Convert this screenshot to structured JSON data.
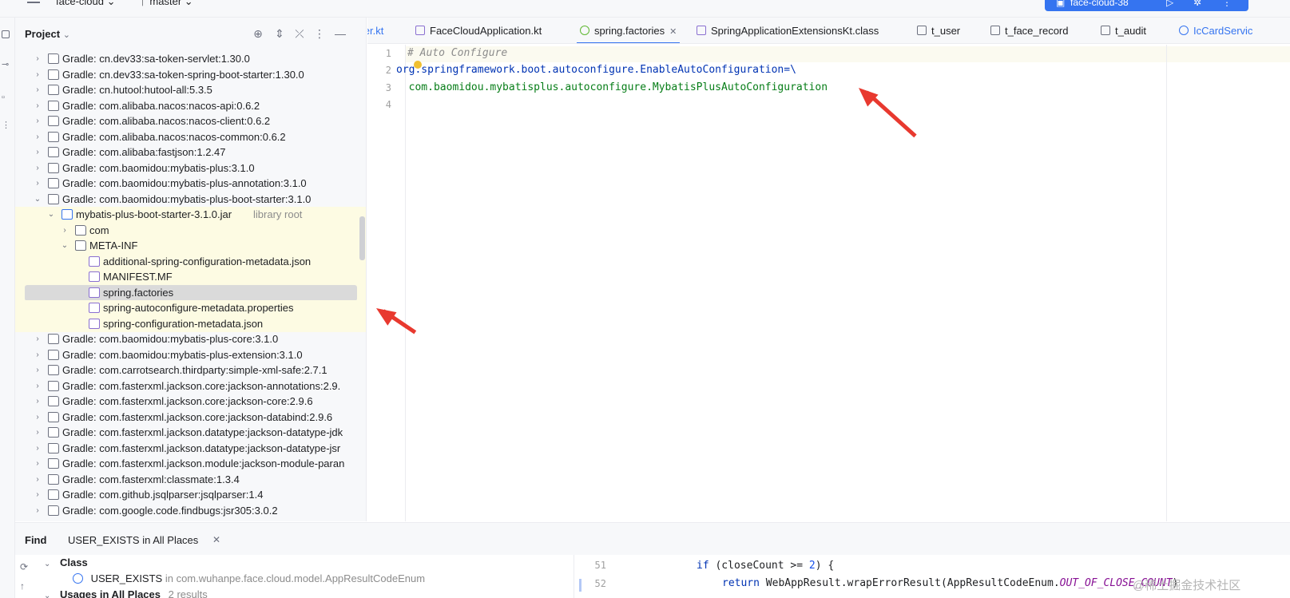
{
  "topbar": {
    "project_name": "face-cloud",
    "branch": "master",
    "run_config": "face-cloud-38"
  },
  "project_panel": {
    "title": "Project",
    "tree": [
      {
        "label": "Gradle: cn.dev33:sa-token-servlet:1.30.0"
      },
      {
        "label": "Gradle: cn.dev33:sa-token-spring-boot-starter:1.30.0"
      },
      {
        "label": "Gradle: cn.hutool:hutool-all:5.3.5"
      },
      {
        "label": "Gradle: com.alibaba.nacos:nacos-api:0.6.2"
      },
      {
        "label": "Gradle: com.alibaba.nacos:nacos-client:0.6.2"
      },
      {
        "label": "Gradle: com.alibaba.nacos:nacos-common:0.6.2"
      },
      {
        "label": "Gradle: com.alibaba:fastjson:1.2.47"
      },
      {
        "label": "Gradle: com.baomidou:mybatis-plus:3.1.0"
      },
      {
        "label": "Gradle: com.baomidou:mybatis-plus-annotation:3.1.0"
      },
      {
        "label": "Gradle: com.baomidou:mybatis-plus-boot-starter:3.1.0"
      },
      {
        "label": "mybatis-plus-boot-starter-3.1.0.jar",
        "suffix": "library root"
      },
      {
        "label": "com"
      },
      {
        "label": "META-INF"
      },
      {
        "label": "additional-spring-configuration-metadata.json"
      },
      {
        "label": "MANIFEST.MF"
      },
      {
        "label": "spring.factories"
      },
      {
        "label": "spring-autoconfigure-metadata.properties"
      },
      {
        "label": "spring-configuration-metadata.json"
      },
      {
        "label": "Gradle: com.baomidou:mybatis-plus-core:3.1.0"
      },
      {
        "label": "Gradle: com.baomidou:mybatis-plus-extension:3.1.0"
      },
      {
        "label": "Gradle: com.carrotsearch.thirdparty:simple-xml-safe:2.7.1"
      },
      {
        "label": "Gradle: com.fasterxml.jackson.core:jackson-annotations:2.9."
      },
      {
        "label": "Gradle: com.fasterxml.jackson.core:jackson-core:2.9.6"
      },
      {
        "label": "Gradle: com.fasterxml.jackson.core:jackson-databind:2.9.6"
      },
      {
        "label": "Gradle: com.fasterxml.jackson.datatype:jackson-datatype-jdk"
      },
      {
        "label": "Gradle: com.fasterxml.jackson.datatype:jackson-datatype-jsr"
      },
      {
        "label": "Gradle: com.fasterxml.jackson.module:jackson-module-paran"
      },
      {
        "label": "Gradle: com.fasterxml:classmate:1.3.4"
      },
      {
        "label": "Gradle: com.github.jsqlparser:jsqlparser:1.4"
      },
      {
        "label": "Gradle: com.google.code.findbugs:jsr305:3.0.2"
      }
    ]
  },
  "tabs": [
    {
      "label": "ller.kt"
    },
    {
      "label": "FaceCloudApplication.kt"
    },
    {
      "label": "spring.factories",
      "active": true
    },
    {
      "label": "SpringApplicationExtensionsKt.class"
    },
    {
      "label": "t_user"
    },
    {
      "label": "t_face_record"
    },
    {
      "label": "t_audit"
    },
    {
      "label": "IcCardServic"
    }
  ],
  "editor": {
    "line_numbers": [
      "1",
      "2",
      "3",
      "4"
    ],
    "lines": [
      {
        "text": "# Auto Configure"
      },
      {
        "key": "org.springframework.boot.autoconfigure.EnableAutoConfiguration",
        "sep": "=\\"
      },
      {
        "text": "  com.baomidou.mybatisplus.autoconfigure.MybatisPlusAutoConfiguration"
      },
      {
        "text": ""
      }
    ]
  },
  "find_panel": {
    "title": "Find",
    "tab_label": "USER_EXISTS in All Places",
    "class_group": "Class",
    "class_item": "USER_EXISTS",
    "class_item_location": "in com.wuhanpe.face.cloud.model.AppResultCodeEnum",
    "usages_group": "Usages in All Places",
    "usages_count": "2 results",
    "preview": {
      "lines": [
        {
          "num": "51",
          "kw": "if",
          "rest_a": " (closeCount >= ",
          "num_lit": "2",
          "rest_b": ") {"
        },
        {
          "num": "52",
          "kw": "return",
          "rest_a": " WebAppResult.wrapErrorResult(AppResultCodeEnum.",
          "enum": "OUT_OF_CLOSE_COUNT",
          "rest_b": ")"
        }
      ]
    }
  },
  "watermark": "@稀土掘金技术社区"
}
